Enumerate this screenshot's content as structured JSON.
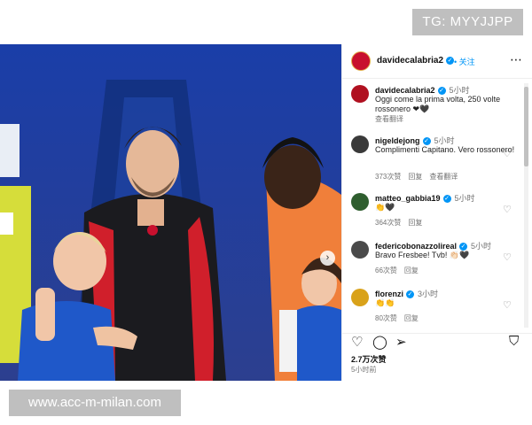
{
  "watermarks": {
    "top": "TG: MYYJJPP",
    "bottom": "www.acc-m-milan.com"
  },
  "post": {
    "next_icon": "chevron-right-icon",
    "slide_count": 4
  },
  "header": {
    "username": "davidecalabria2",
    "follow_label": "关注",
    "more_icon": "⋯"
  },
  "comments": [
    {
      "username": "davidecalabria2",
      "time": "5小时",
      "text": "Oggi come la prima volta, 250 volte rossonero ❤🖤",
      "meta": [
        "查看翻译"
      ],
      "liked_icon": false,
      "avatar_color": "#b01020"
    },
    {
      "username": "nigeldejong",
      "time": "5小时",
      "text": "Complimenti Capitano. Vero rossonero!",
      "meta": [
        "373次赞",
        "回复",
        "查看翻译"
      ],
      "liked_icon": true,
      "avatar_color": "#3a3a3a"
    },
    {
      "username": "matteo_gabbia19",
      "time": "5小时",
      "text": "👏🖤",
      "meta": [
        "364次赞",
        "回复"
      ],
      "liked_icon": true,
      "avatar_color": "#2f5e2f"
    },
    {
      "username": "federicobonazzolireal",
      "time": "5小时",
      "text": "Bravo Fresbee! Tvb! 👏🏻🖤",
      "meta": [
        "66次赞",
        "回复"
      ],
      "liked_icon": true,
      "avatar_color": "#4a4a4a"
    },
    {
      "username": "florenzi",
      "time": "3小时",
      "text": "👏👏",
      "meta": [
        "80次赞",
        "回复"
      ],
      "liked_icon": true,
      "avatar_color": "#d9a21a"
    }
  ],
  "actions": {
    "likes": "2.7万次赞",
    "post_time": "5小时前"
  }
}
